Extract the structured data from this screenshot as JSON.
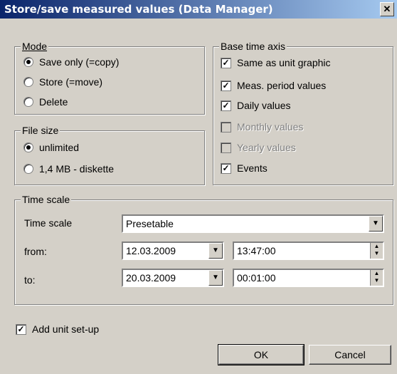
{
  "window": {
    "title": "Store/save measured values (Data Manager)",
    "close_label": "✕"
  },
  "mode": {
    "legend": "Mode",
    "options": [
      {
        "label": "Save only (=copy)",
        "selected": true
      },
      {
        "label": "Store (=move)",
        "selected": false
      },
      {
        "label": "Delete",
        "selected": false
      }
    ]
  },
  "file_size": {
    "legend": "File size",
    "options": [
      {
        "label": "unlimited",
        "selected": true
      },
      {
        "label": "1,4 MB - diskette",
        "selected": false
      }
    ]
  },
  "base_time_axis": {
    "legend": "Base time axis",
    "options": [
      {
        "label": "Same as unit graphic",
        "checked": true,
        "enabled": true
      },
      {
        "label": "Meas. period values",
        "checked": true,
        "enabled": true
      },
      {
        "label": "Daily values",
        "checked": true,
        "enabled": true
      },
      {
        "label": "Monthly values",
        "checked": false,
        "enabled": false
      },
      {
        "label": "Yearly values",
        "checked": false,
        "enabled": false
      },
      {
        "label": "Events",
        "checked": true,
        "enabled": true
      }
    ]
  },
  "time_scale": {
    "legend": "Time scale",
    "label": "Time scale",
    "value": "Presetable",
    "from_label": "from:",
    "from_date": "12.03.2009",
    "from_time": "13:47:00",
    "to_label": "to:",
    "to_date": "20.03.2009",
    "to_time": "00:01:00"
  },
  "add_unit_setup": {
    "label": "Add unit set-up",
    "checked": true
  },
  "buttons": {
    "ok": "OK",
    "cancel": "Cancel"
  }
}
